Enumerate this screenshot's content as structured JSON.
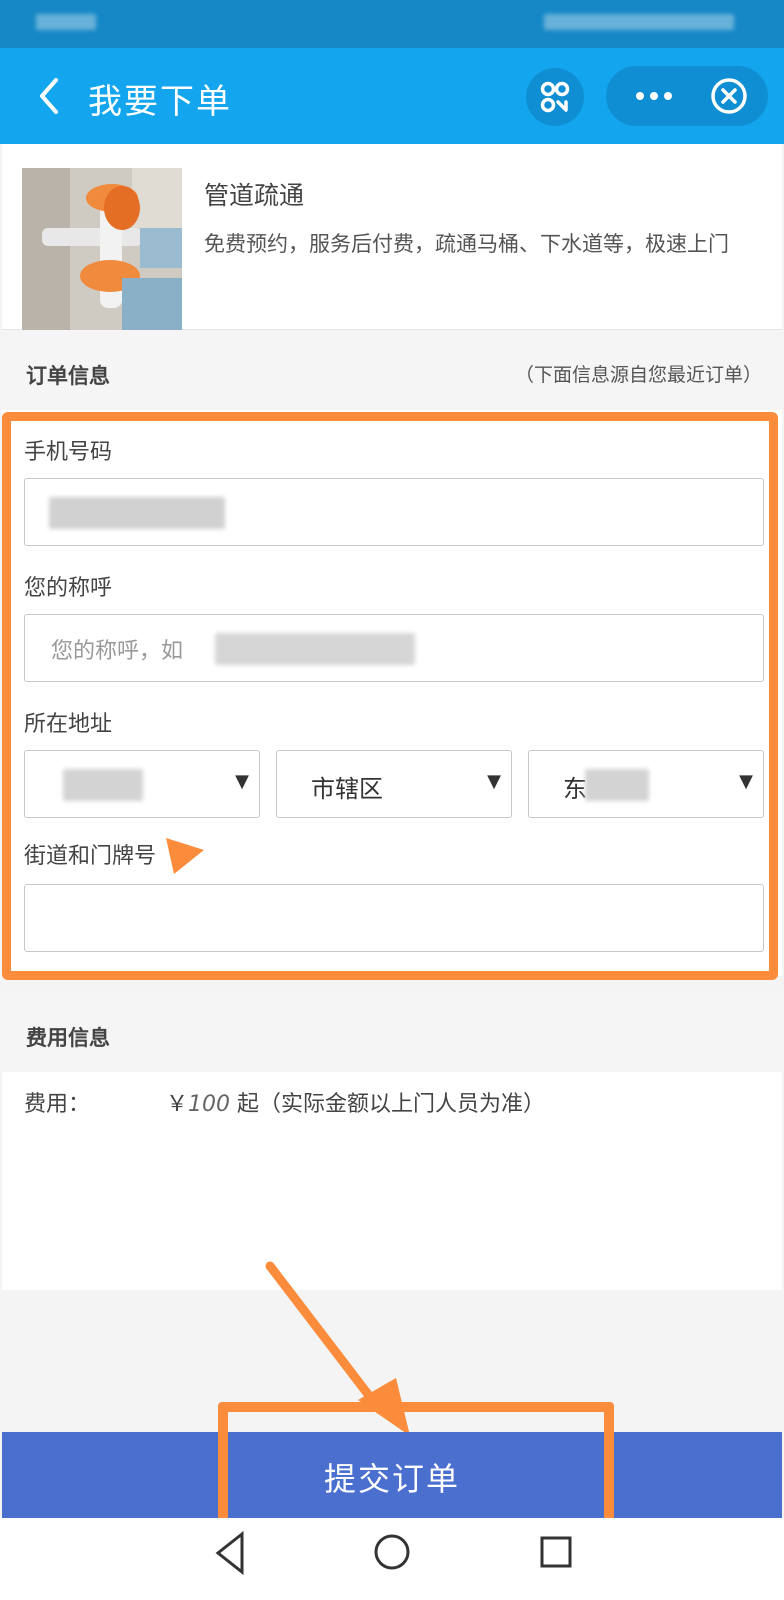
{
  "header": {
    "title": "我要下单"
  },
  "product": {
    "name": "管道疏通",
    "description": "免费预约，服务后付费，疏通马桶、下水道等，极速上门"
  },
  "order_section": {
    "title": "订单信息",
    "note": "（下面信息源自您最近订单）"
  },
  "form": {
    "phone_label": "手机号码",
    "name_label": "您的称呼",
    "name_placeholder": "您的称呼，如",
    "address_label": "所在地址",
    "city_select": "",
    "district_select": "市辖区",
    "street_select": "东",
    "street_label": "街道和门牌号"
  },
  "fee_section": {
    "title": "费用信息",
    "label": "费用：",
    "currency": "￥",
    "amount": "100",
    "suffix": " 起（实际金额以上门人员为准）"
  },
  "submit": {
    "label": "提交订单"
  },
  "colors": {
    "header_bg": "#13a6ee",
    "submit_bg": "#4a6fcf",
    "annotation": "#fb8c3b"
  }
}
